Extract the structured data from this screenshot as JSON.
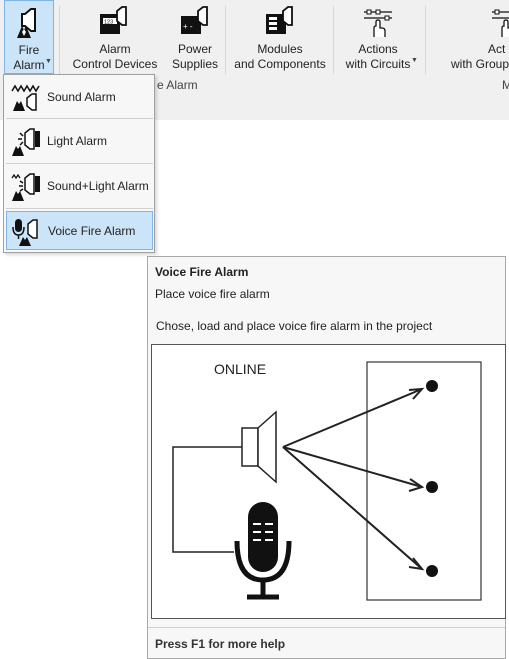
{
  "ribbon": {
    "buttons": [
      {
        "line1": "Fire",
        "line2": "Alarm"
      },
      {
        "line1": "Alarm",
        "line2": "Control Devices"
      },
      {
        "line1": "Power",
        "line2": "Supplies"
      },
      {
        "line1": "Modules",
        "line2": "and Components"
      },
      {
        "line1": "Actions",
        "line2": "with Circuits"
      },
      {
        "line1": "Act",
        "line2": "with Group"
      }
    ],
    "group_label": "e Alarm",
    "group_label_right": "M"
  },
  "menu": {
    "items": [
      {
        "label": "Sound Alarm",
        "icon": "sound-alarm-icon"
      },
      {
        "label": "Light Alarm",
        "icon": "light-alarm-icon"
      },
      {
        "label": "Sound+Light Alarm",
        "icon": "sound-light-alarm-icon"
      },
      {
        "label": "Voice Fire Alarm",
        "icon": "voice-fire-alarm-icon",
        "selected": true
      }
    ]
  },
  "tooltip": {
    "title": "Voice Fire Alarm",
    "short": "Place voice fire alarm",
    "description": "Chose, load and place voice fire alarm in the project",
    "image_label": "ONLINE",
    "footer": "Press F1 for more help"
  },
  "colors": {
    "ribbon_bg": "#f0f0f0",
    "selection_bg": "#cce4f7",
    "selection_border": "#7eb4ea"
  }
}
